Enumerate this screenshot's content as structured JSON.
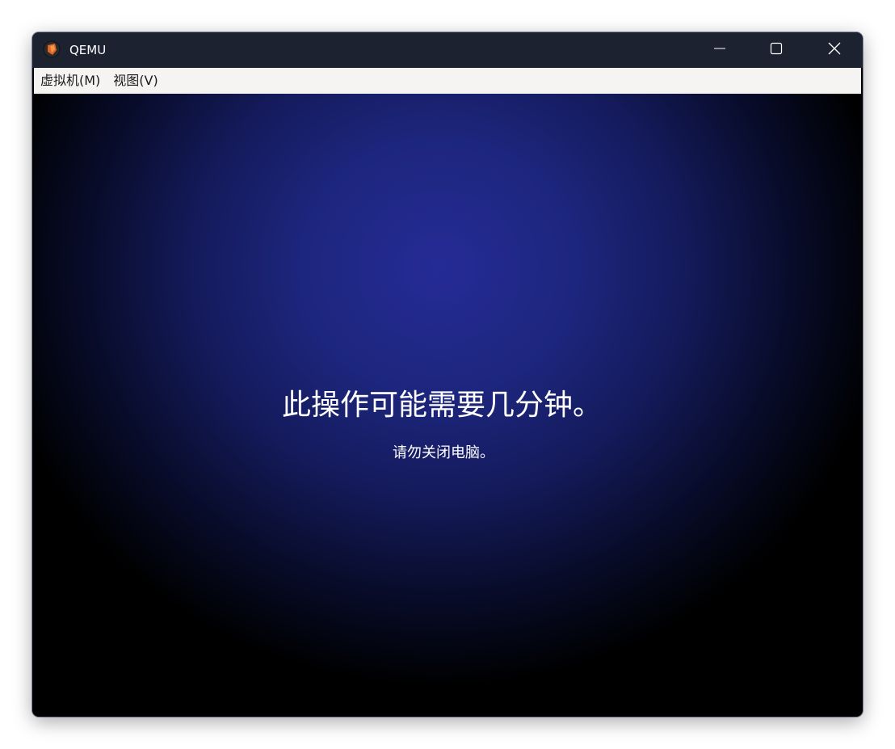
{
  "window": {
    "title": "QEMU",
    "controls": {
      "minimize": "minimize-icon",
      "maximize": "maximize-icon",
      "close": "close-icon"
    },
    "colors": {
      "titlebar": "#1d2231",
      "menubar": "#f5f4f2",
      "screen_center": "#252b96",
      "screen_edge": "#000000"
    }
  },
  "menubar": {
    "items": [
      {
        "label": "虚拟机(M)"
      },
      {
        "label": "视图(V)"
      }
    ]
  },
  "screen": {
    "headline": "此操作可能需要几分钟。",
    "subline": "请勿关闭电脑。"
  }
}
